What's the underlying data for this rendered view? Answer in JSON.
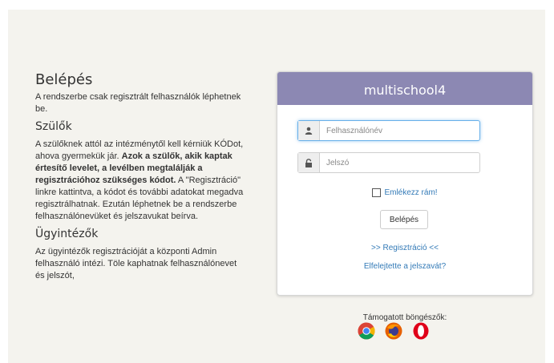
{
  "info": {
    "title": "Belépés",
    "intro": "A rendszerbe csak regisztrált felhasználók léphetnek be.",
    "parents_heading": "Szülők",
    "parents_p1": "A szülőknek attól az intézménytől kell kérniük KÓDot, ahova gyermekük jár. ",
    "parents_bold": "Azok a szülők, akik kaptak értesítő levelet, a levélben megtalálják a regisztrációhoz szükséges kódot.",
    "parents_p2": " A \"Regisztráció\" linkre kattintva, a kódot és további adatokat megadva regisztrálhatnak. Ezután léphetnek be a rendszerbe felhasználónevüket és jelszavukat beírva.",
    "admin_heading": "Ügyintézők",
    "admin_text": "Az ügyintézők regisztrációját a központi Admin felhasználó intézi. Töle kaphatnak felhasználónevet és jelszót,"
  },
  "login": {
    "header": "multischool4",
    "username_placeholder": "Felhasználónév",
    "username_value": "",
    "password_placeholder": "Jelszó",
    "password_value": "",
    "remember_label": "Emlékezz rám!",
    "login_button": "Belépés",
    "register_link": ">> Regisztráció <<",
    "forgot_link": "Elfelejtette a jelszavát?"
  },
  "browsers": {
    "label": "Támogatott böngészők:",
    "icons": [
      "chrome-icon",
      "firefox-icon",
      "opera-icon"
    ]
  },
  "colors": {
    "header_bg": "#8c88b3",
    "link": "#337ab7",
    "page_bg": "#f4f3ee"
  }
}
